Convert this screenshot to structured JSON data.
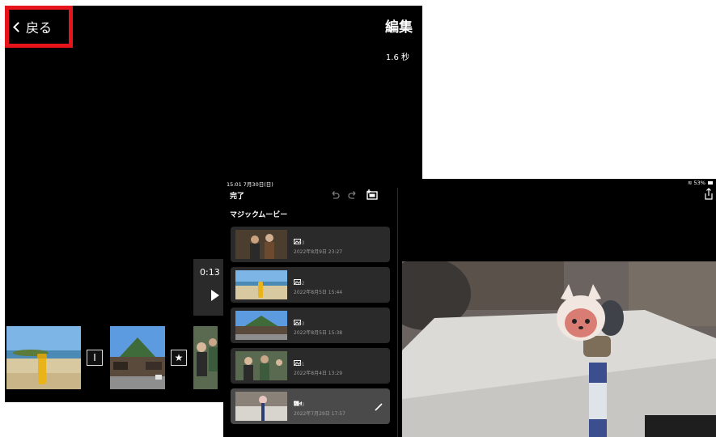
{
  "back_screen": {
    "back_label": "戻る",
    "title": "編集",
    "duration": "1.6 秒",
    "player_time": "0:13",
    "transition_1": "I",
    "transition_2": "★"
  },
  "front_screen": {
    "status": {
      "clock": "15:01  7月30日(日)",
      "battery": "53%"
    },
    "done_label": "完了",
    "list_title": "マジックムービー",
    "clips": [
      {
        "kind": "photo",
        "duration": "0:03",
        "date": "2022年8月9日 23:27"
      },
      {
        "kind": "photo",
        "duration": "0:02",
        "date": "2022年8月5日 15:44"
      },
      {
        "kind": "photo",
        "duration": "0:03",
        "date": "2022年8月5日 15:38"
      },
      {
        "kind": "photo",
        "duration": "0:01",
        "date": "2022年8月4日 13:29"
      },
      {
        "kind": "video",
        "duration": "0:03",
        "date": "2022年7月29日 17:57",
        "selected": true
      }
    ]
  },
  "colors": {
    "highlight": "#e8141b",
    "background": "#000000",
    "cell": "#2a2a2a"
  },
  "icons": [
    "chevron-left-icon",
    "play-icon",
    "undo-icon",
    "redo-icon",
    "storyboard-add-icon",
    "share-icon",
    "photo-icon",
    "video-icon",
    "pencil-icon",
    "wifi-icon",
    "battery-icon"
  ]
}
